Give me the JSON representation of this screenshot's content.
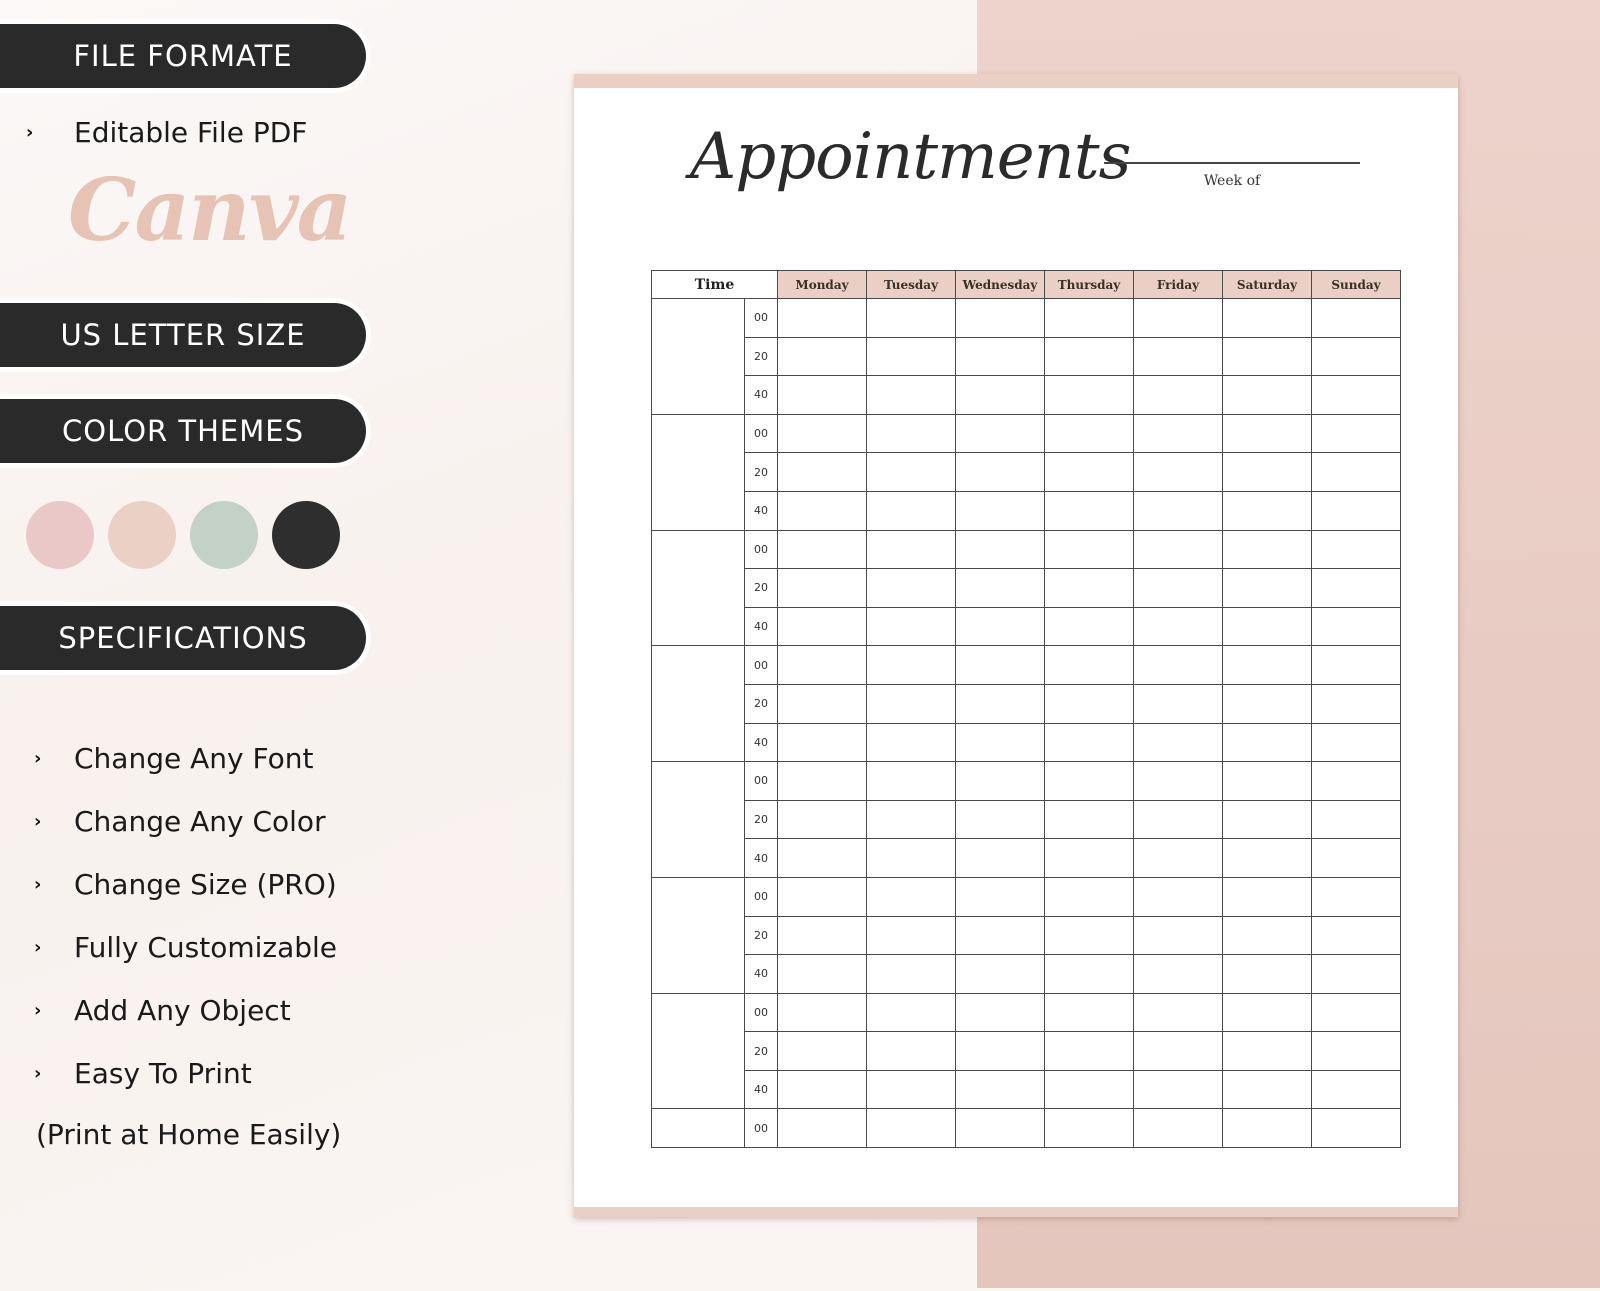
{
  "left_panel": {
    "file_format": {
      "heading": "FILE FORMATE",
      "items": [
        "Editable File PDF"
      ],
      "brand_logo_text": "Canva"
    },
    "size_heading": "US LETTER SIZE",
    "color_themes": {
      "heading": "COLOR THEMES",
      "swatches": [
        {
          "name": "blush-pink",
          "color": "#ebc8c8"
        },
        {
          "name": "nude-beige",
          "color": "#ebd0c6"
        },
        {
          "name": "sage-green",
          "color": "#c4d1c7"
        },
        {
          "name": "charcoal",
          "color": "#2e2e2e"
        }
      ]
    },
    "specifications": {
      "heading": "SPECIFICATIONS",
      "items": [
        "Change Any Font",
        "Change Any Color",
        "Change Size (PRO)",
        "Fully Customizable",
        "Add Any Object",
        "Easy To Print"
      ],
      "note": "(Print at Home Easily)"
    },
    "bullet_glyph": "›"
  },
  "planner": {
    "title": "Appointments",
    "week_label": "Week of",
    "time_header": "Time",
    "days": [
      "Monday",
      "Tuesday",
      "Wednesday",
      "Thursday",
      "Friday",
      "Saturday",
      "Sunday"
    ],
    "minute_marks": [
      "00",
      "20",
      "40"
    ],
    "hour_blocks": 7,
    "final_row_minute": "00",
    "header_color": "#ebcfc4"
  }
}
